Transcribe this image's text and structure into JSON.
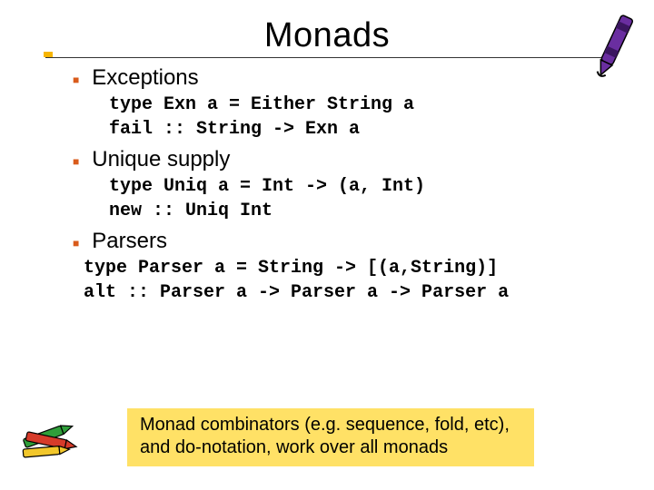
{
  "title": "Monads",
  "sections": [
    {
      "heading": "Exceptions",
      "code": [
        "type Exn a = Either String a",
        "fail :: String -> Exn a"
      ]
    },
    {
      "heading": "Unique supply",
      "code": [
        "type Uniq a = Int -> (a, Int)",
        "new :: Uniq Int"
      ]
    },
    {
      "heading": "Parsers",
      "code": [
        "type Parser a = String -> [(a,String)]",
        "alt :: Parser a -> Parser a -> Parser a"
      ]
    }
  ],
  "note": "Monad combinators (e.g. sequence, fold, etc), and do-notation, work over all monads"
}
